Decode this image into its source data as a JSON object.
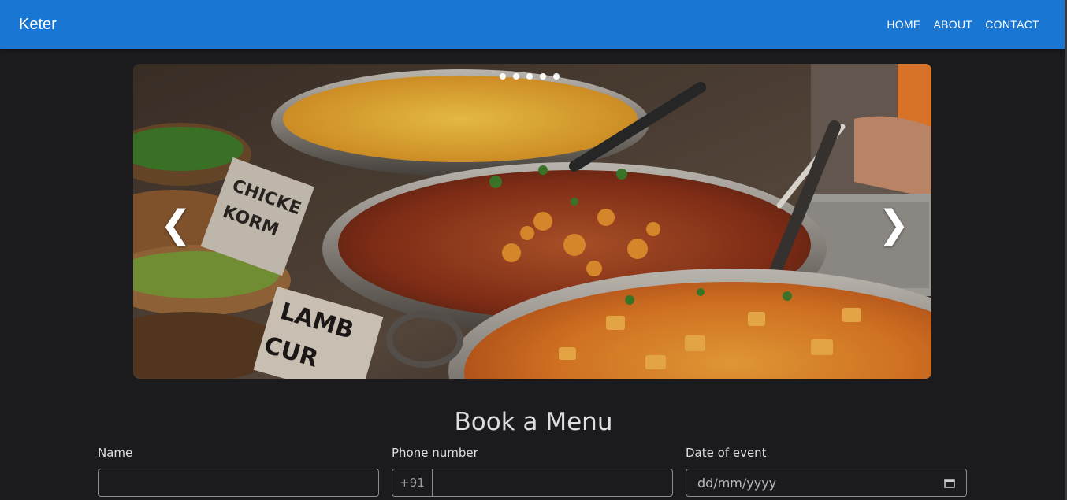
{
  "header": {
    "brand": "Keter",
    "nav": [
      "HOME",
      "ABOUT",
      "CONTACT"
    ]
  },
  "carousel": {
    "image": "photo of pans of Indian curries with signs reading LAMB and CHICKEN KORMA",
    "sign_text": [
      "LAMB",
      "CUR",
      "CHICKE",
      "KORM"
    ],
    "slide_count": 5,
    "prev_label": "❮",
    "next_label": "❯"
  },
  "booking": {
    "title": "Book a Menu",
    "name_label": "Name",
    "phone_label": "Phone number",
    "phone_prefix": "+91",
    "date_label": "Date of event",
    "date_placeholder": "dd/mm/yyyy"
  },
  "colors": {
    "navbar": "#1976d2",
    "background": "#1b1a1d",
    "text": "#dedde2"
  }
}
